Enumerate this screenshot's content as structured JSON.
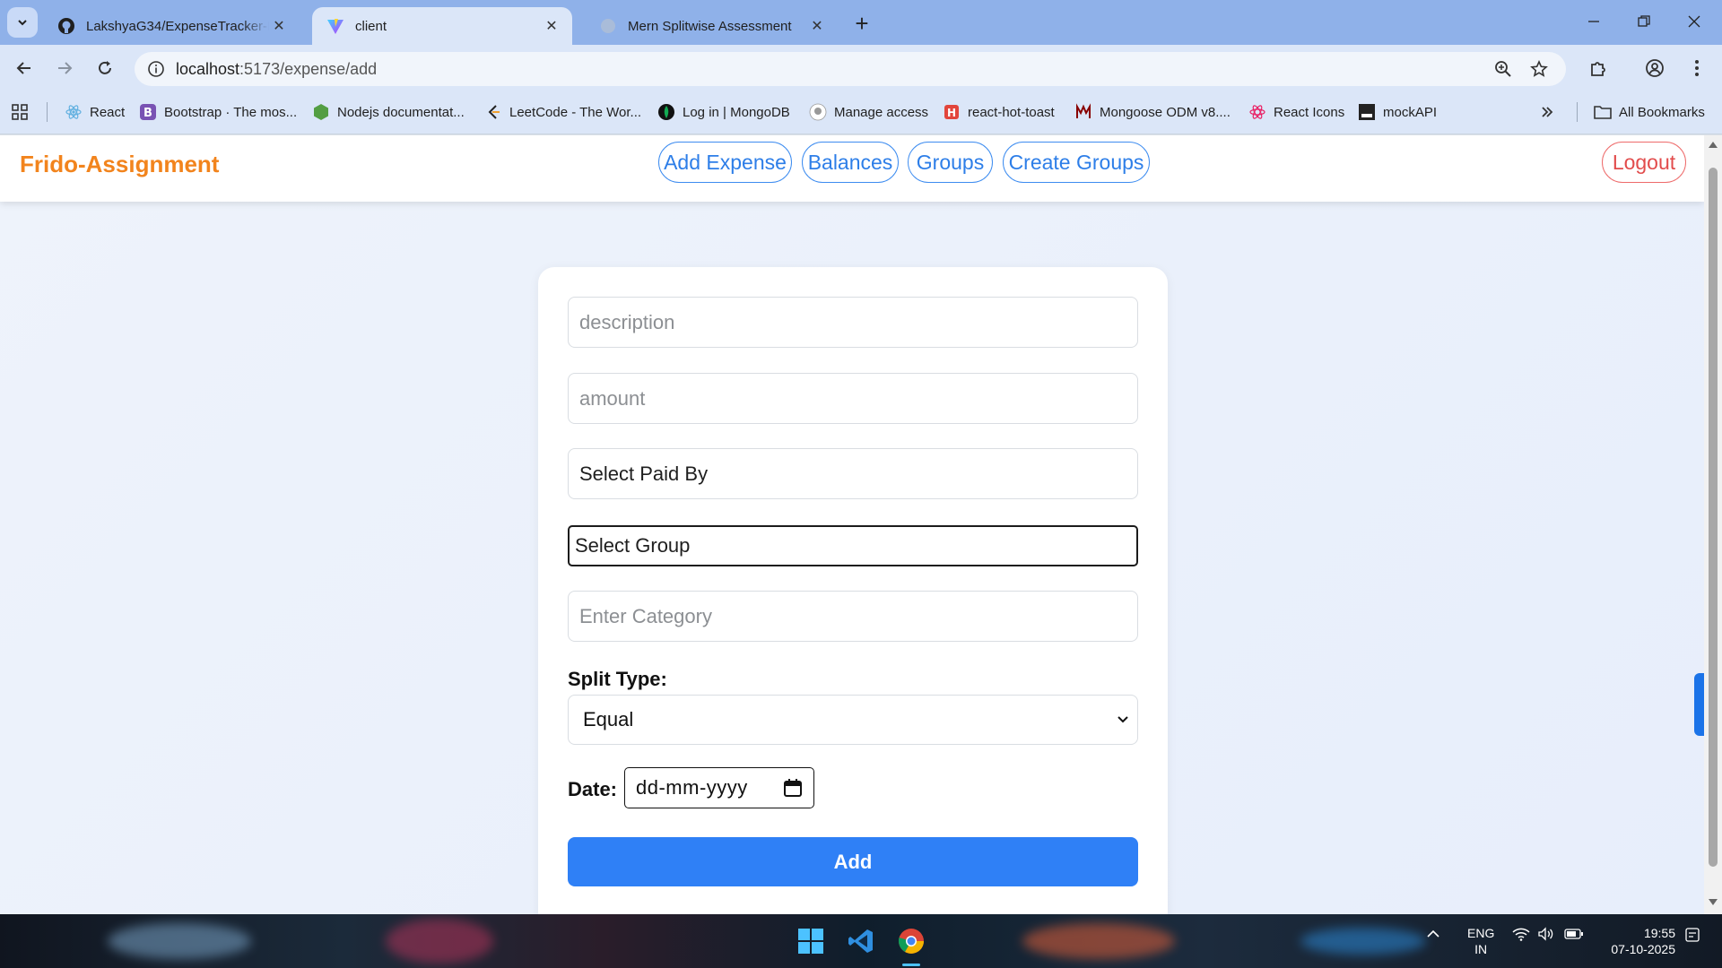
{
  "browser": {
    "tabs": [
      {
        "title": "LakshyaG34/ExpenseTracker-Fri",
        "icon": "github-icon",
        "active": false
      },
      {
        "title": "client",
        "icon": "vite-icon",
        "active": true
      },
      {
        "title": "Mern Splitwise Assessment",
        "icon": "globe-icon",
        "active": false
      }
    ],
    "url_host": "localhost",
    "url_path": ":5173/expense/add",
    "bookmarks": [
      {
        "label": "React",
        "icon": "react-icon"
      },
      {
        "label": "Bootstrap · The mos...",
        "icon": "bootstrap-icon"
      },
      {
        "label": "Nodejs documentat...",
        "icon": "nodejs-icon"
      },
      {
        "label": "LeetCode - The Wor...",
        "icon": "leetcode-icon"
      },
      {
        "label": "Log in | MongoDB",
        "icon": "mongodb-icon"
      },
      {
        "label": "Manage access",
        "icon": "github-icon"
      },
      {
        "label": "react-hot-toast",
        "icon": "hot-toast-icon"
      },
      {
        "label": "Mongoose ODM v8....",
        "icon": "mongoose-icon"
      },
      {
        "label": "React Icons",
        "icon": "react-icons-icon"
      },
      {
        "label": "mockAPI",
        "icon": "mockapi-icon"
      }
    ],
    "all_bookmarks_label": "All Bookmarks"
  },
  "navbar": {
    "brand": "Frido-Assignment",
    "links": [
      "Add Expense",
      "Balances",
      "Groups",
      "Create Groups"
    ],
    "logout": "Logout"
  },
  "form": {
    "description_placeholder": "description",
    "amount_placeholder": "amount",
    "paid_by_value": "Select Paid By",
    "group_value": "Select Group",
    "category_placeholder": "Enter Category",
    "split_type_label": "Split Type:",
    "split_type_value": "Equal",
    "date_label": "Date:",
    "date_placeholder": "dd-mm-yyyy",
    "submit_label": "Add"
  },
  "taskbar": {
    "language": "ENG",
    "region": "IN",
    "time": "19:55",
    "date": "07-10-2025"
  },
  "colors": {
    "brand": "#f2841d",
    "nav_accent": "#2d7ee8",
    "logout": "#e24c4c",
    "primary_button": "#2f80f6"
  }
}
